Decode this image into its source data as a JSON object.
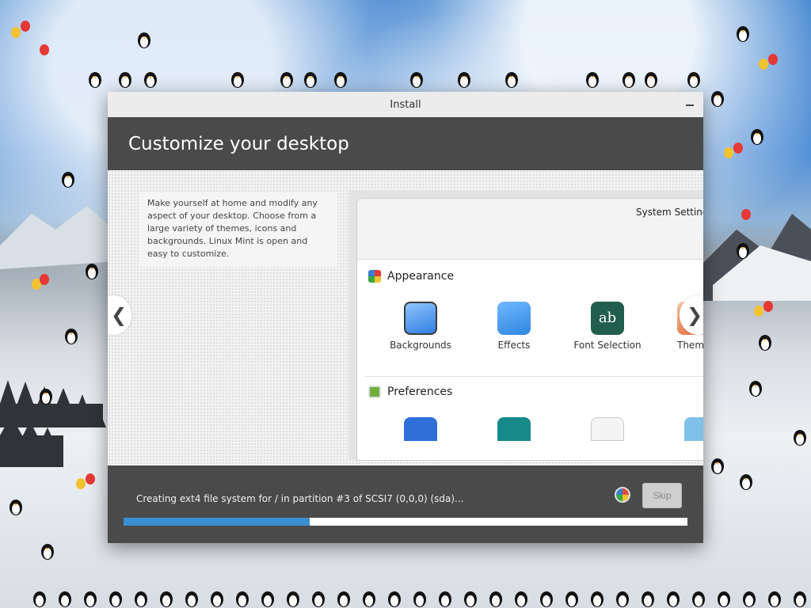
{
  "window": {
    "title": "Install"
  },
  "header": {
    "title": "Customize your desktop"
  },
  "slide": {
    "description": "Make yourself at home and modify any aspect of your desktop. Choose from a large variety of themes, icons and backgrounds. Linux Mint is open and easy to customize.",
    "prev_label": "❮",
    "next_label": "❯",
    "screenshot": {
      "title": "System Settings",
      "appearance_label": "Appearance",
      "preferences_label": "Preferences",
      "apps": [
        {
          "label": "Backgrounds",
          "icon": "backgrounds-icon"
        },
        {
          "label": "Effects",
          "icon": "effects-icon"
        },
        {
          "label": "Font Selection",
          "icon": "font-selection-icon"
        },
        {
          "label": "Themes",
          "icon": "themes-icon"
        }
      ]
    }
  },
  "footer": {
    "status": "Creating ext4 file system for / in partition #3 of SCSI7 (0,0,0) (sda)...",
    "skip_label": "Skip",
    "progress": 0.33
  },
  "colors": {
    "header_bg": "#4a4a4a",
    "progress_fill": "#3a8fd0"
  }
}
